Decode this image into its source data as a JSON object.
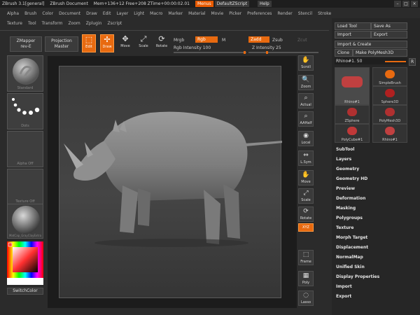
{
  "titlebar": {
    "app": "ZBrush 3.1[general]",
    "document": "ZBrush Document",
    "mem": "Mem+136+12 Free+208 ZTime+00:00:02.01",
    "menus_label": "Menus",
    "script_label": "DefaultZScript",
    "help_label": "Help"
  },
  "menu_row1": [
    "Alpha",
    "Brush",
    "Color",
    "Document",
    "Draw",
    "Edit",
    "Layer",
    "Light",
    "Macro",
    "Marker",
    "Material",
    "Movie",
    "Picker",
    "Preferences",
    "Render",
    "Stencil",
    "Stroke"
  ],
  "menu_row2": [
    "Texture",
    "Tool",
    "Transform",
    "Zoom",
    "Zplugin",
    "Zscript"
  ],
  "toolbar": {
    "zmapper_label": "ZMapper",
    "zmapper_sub": "rev-E",
    "projection_label": "Projection",
    "projection_sub": "Master",
    "edit_label": "Edit",
    "draw_label": "Draw",
    "move_label": "Move",
    "scale_label": "Scale",
    "rotate_label": "Rotate",
    "mrgb_label": "Mrgb",
    "rgb_label": "Rgb",
    "m_label": "M",
    "rgb_intensity_label": "Rgb Intensity 100",
    "rgb_intensity_value": 100,
    "zadd_label": "Zadd",
    "zsub_label": "Zsub",
    "zcut_label": "Zcut",
    "z_intensity_label": "Z Intensity 25",
    "z_intensity_value": 25
  },
  "left_shelf": {
    "brush": "Standard",
    "stroke": "Dots",
    "alpha": "Alpha Off",
    "texture": "Texture Off",
    "material": "MatCap_GrayClayExtra",
    "switch_color": "SwitchColor"
  },
  "right_shelf": [
    "Scroll",
    "Zoom",
    "Actual",
    "AAHalf",
    "Local",
    "L.Sym",
    "Move",
    "Scale",
    "Rotate",
    "XYZ",
    "Frame",
    "Poly",
    "Lasso"
  ],
  "right_panel": {
    "load_tool": "Load Tool",
    "save_as": "Save As",
    "import": "Import",
    "export": "Export",
    "import_create": "Import & Create",
    "clone": "Clone",
    "make_polymesh": "Make PolyMesh3D",
    "current_tool": "Rhino#1. 50",
    "r_label": "R",
    "tools": [
      {
        "name": "Rhino#1"
      },
      {
        "name": "SimpleBrush"
      },
      {
        "name": "Sphere3D"
      },
      {
        "name": "ZSphere"
      },
      {
        "name": "PolyMesh3D"
      },
      {
        "name": "PolyCube#1"
      },
      {
        "name": "Rhino#1"
      }
    ],
    "sections": [
      "SubTool",
      "Layers",
      "Geometry",
      "Geometry HD",
      "Preview",
      "Deformation",
      "Masking",
      "Polygroups",
      "Texture",
      "Morph Target",
      "Displacement",
      "NormalMap",
      "Unified Skin",
      "Display Properties",
      "Import",
      "Export"
    ]
  },
  "colors": {
    "accent": "#e86a10",
    "canvas_bg": "#3f3f3f",
    "model": "#8a8a8a"
  }
}
